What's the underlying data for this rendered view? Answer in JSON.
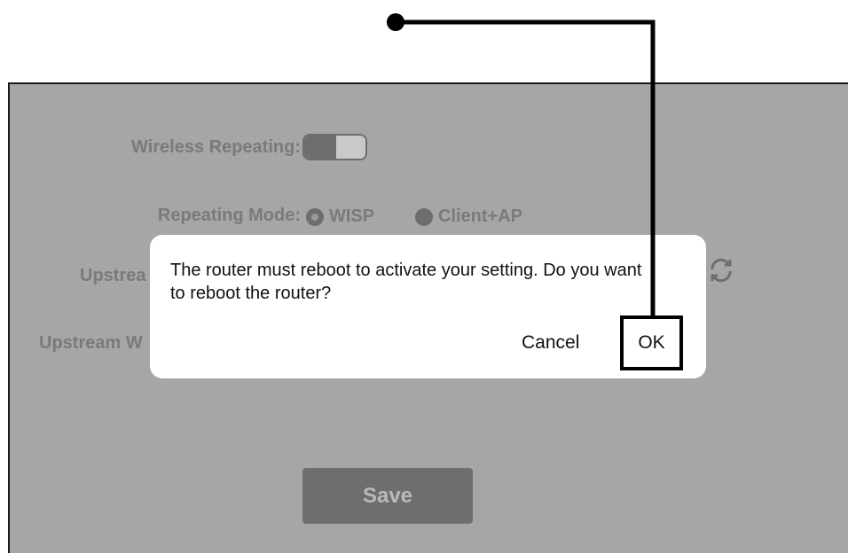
{
  "settings": {
    "wireless_repeating_label": "Wireless Repeating:",
    "wireless_repeating_enabled": true,
    "repeating_mode_label": "Repeating Mode:",
    "repeating_mode_options": [
      "WISP",
      "Client+AP"
    ],
    "repeating_mode_selected": "WISP",
    "upstream_label_partial_1": "Upstrea",
    "upstream_label_partial_2": "Upstream W",
    "save_label": "Save",
    "refresh_icon": "refresh-icon"
  },
  "dialog": {
    "message": "The router must reboot to activate your setting.  Do you want to reboot the router?",
    "cancel_label": "Cancel",
    "ok_label": "OK"
  },
  "callout": {
    "color": "#000000",
    "target": "OK"
  },
  "colors": {
    "overlay_gray": "#a6a6a8",
    "dimmed_control": "#6e6e70",
    "dialog_bg": "#ffffff"
  }
}
